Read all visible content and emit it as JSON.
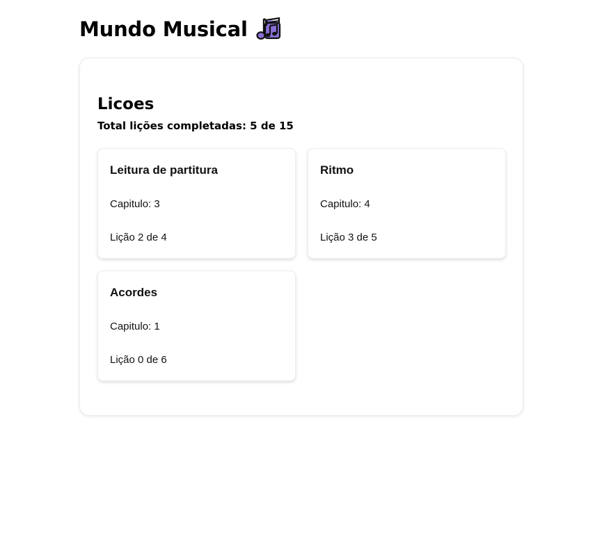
{
  "app": {
    "title": "Mundo Musical",
    "icon": "musical-notes-icon",
    "icon_color": "#8a6fd6"
  },
  "lessons_panel": {
    "heading": "Licoes",
    "summary": "Total lições completadas: 5 de 15",
    "cards": [
      {
        "title": "Leitura de partitura",
        "chapter": "Capitulo: 3",
        "lesson": "Lição 2 de 4"
      },
      {
        "title": "Ritmo",
        "chapter": "Capitulo: 4",
        "lesson": "Lição 3 de 5"
      },
      {
        "title": "Acordes",
        "chapter": "Capitulo: 1",
        "lesson": "Lição 0 de 6"
      }
    ]
  }
}
